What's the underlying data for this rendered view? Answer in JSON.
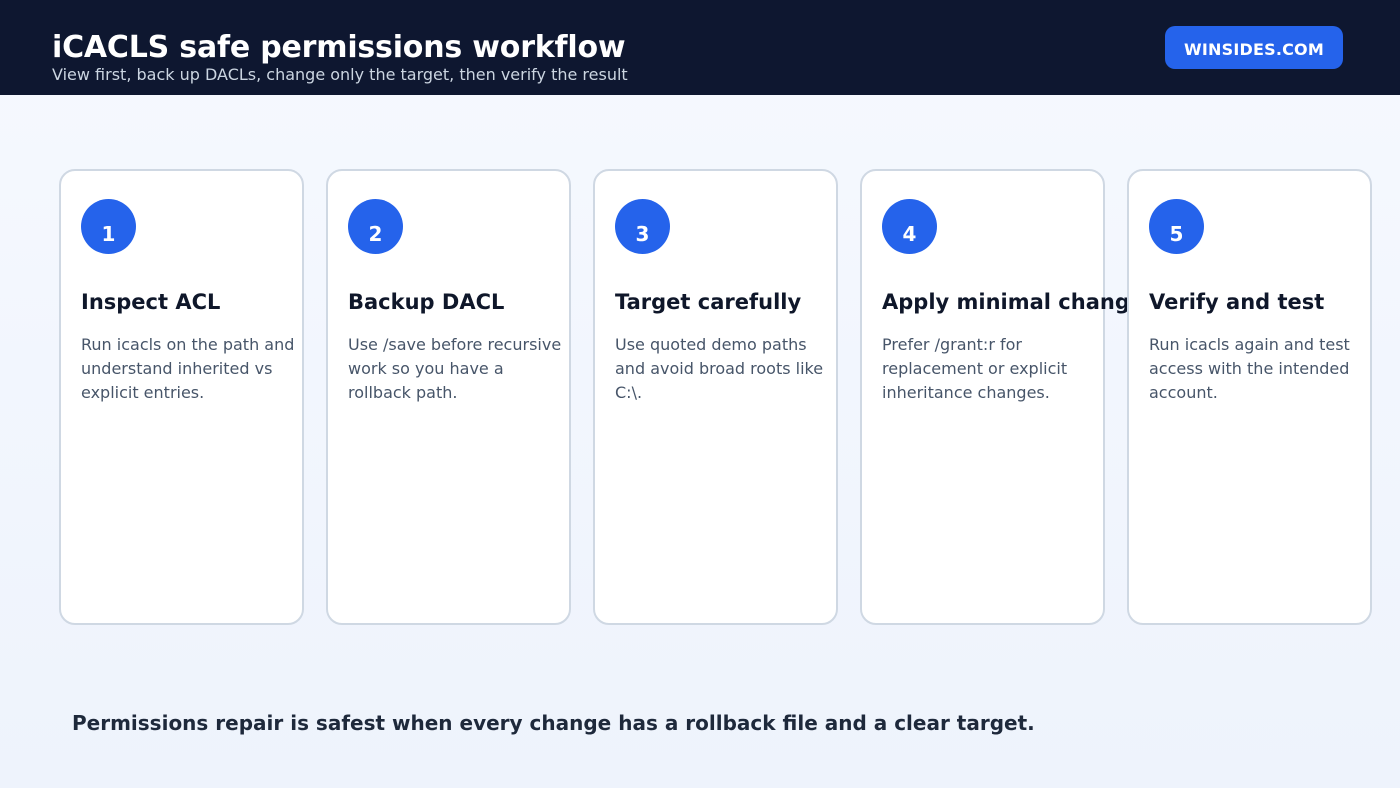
{
  "header": {
    "title": "iCACLS safe permissions workflow",
    "subtitle": "View first, back up DACLs, change only the target, then verify the result",
    "brand": "WINSIDES.COM"
  },
  "colors": {
    "header_bg": "#0e1730",
    "accent": "#2563eb",
    "card_border": "#cfd8e3"
  },
  "steps": [
    {
      "number": "1",
      "title": "Inspect ACL",
      "text": "Run icacls on the path and understand inherited vs explicit entries."
    },
    {
      "number": "2",
      "title": "Backup DACL",
      "text": "Use /save before recursive work so you have a rollback path."
    },
    {
      "number": "3",
      "title": "Target carefully",
      "text": "Use quoted demo paths and avoid broad roots like C:\\."
    },
    {
      "number": "4",
      "title": "Apply minimal change",
      "text": "Prefer /grant:r for replacement or explicit inheritance changes."
    },
    {
      "number": "5",
      "title": "Verify and test",
      "text": "Run icacls again and test access with the intended account."
    }
  ],
  "footer": {
    "note": "Permissions repair is safest when every change has a rollback file and a clear target."
  }
}
